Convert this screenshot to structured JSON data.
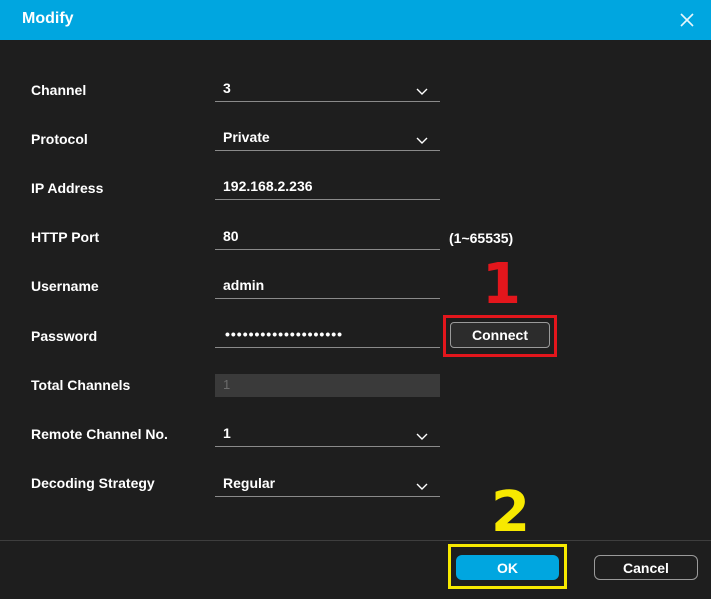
{
  "dialog": {
    "title": "Modify",
    "close_icon": "close-icon",
    "accent_color": "#00a6e0"
  },
  "fields": {
    "channel": {
      "label": "Channel",
      "value": "3"
    },
    "protocol": {
      "label": "Protocol",
      "value": "Private"
    },
    "ip_address": {
      "label": "IP Address",
      "value": "192.168.2.236"
    },
    "http_port": {
      "label": "HTTP Port",
      "value": "80",
      "range_hint": "(1~65535)"
    },
    "username": {
      "label": "Username",
      "value": "admin"
    },
    "password": {
      "label": "Password",
      "masked_value": "••••••••••••••••••••"
    },
    "total_channels": {
      "label": "Total Channels",
      "value": "1"
    },
    "remote_channel": {
      "label": "Remote Channel No.",
      "value": "1"
    },
    "decoding_strategy": {
      "label": "Decoding Strategy",
      "value": "Regular"
    }
  },
  "buttons": {
    "connect": "Connect",
    "ok": "OK",
    "cancel": "Cancel"
  },
  "annotations": {
    "step1": "1",
    "step2": "2",
    "step1_color": "#e3161c",
    "step2_color": "#f7e900"
  }
}
